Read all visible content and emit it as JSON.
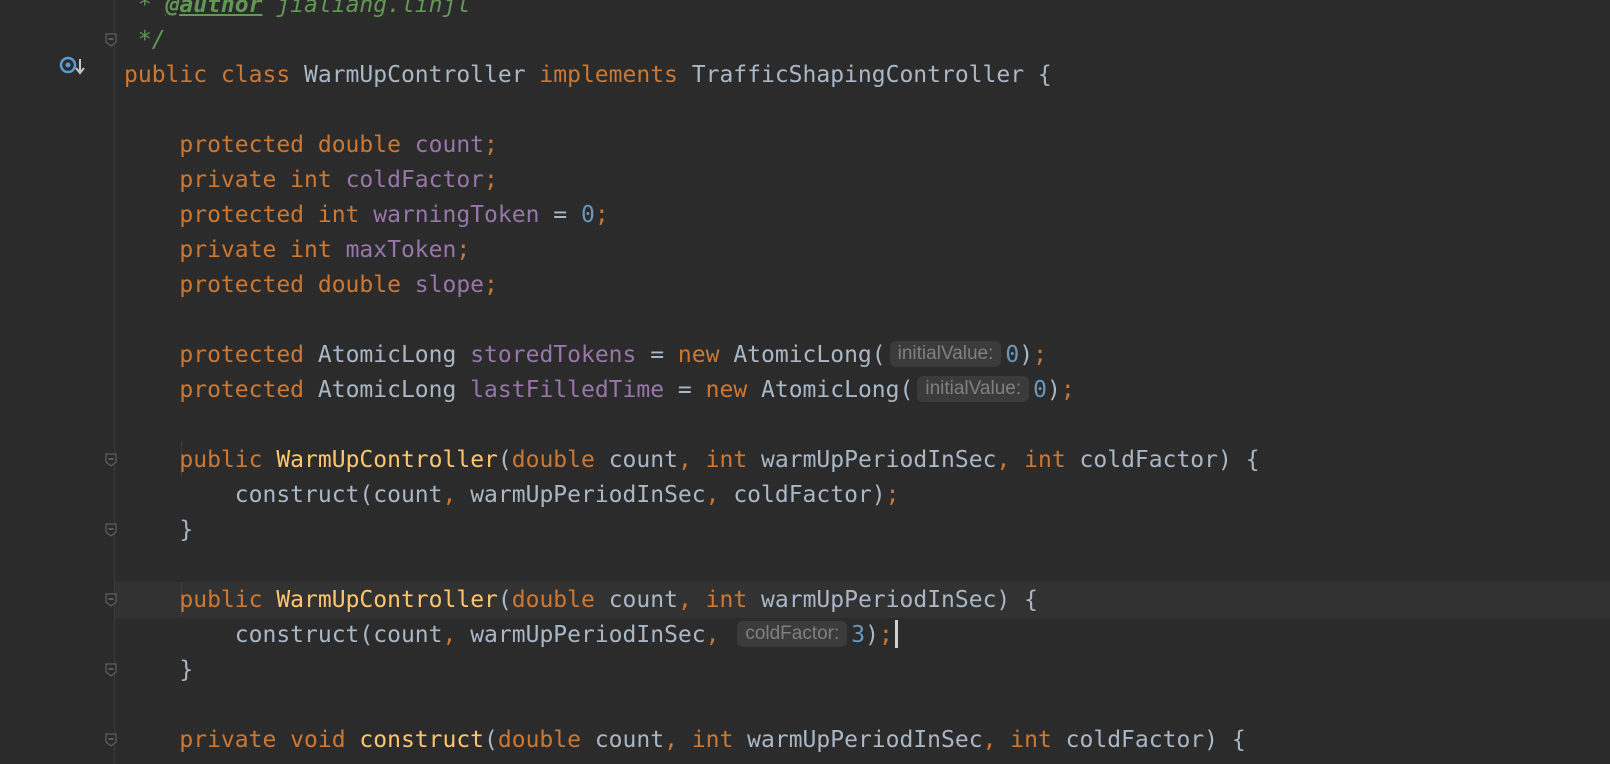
{
  "editor": {
    "language": "Java",
    "caret_line": 17,
    "lines": [
      {
        "tokens": [
          {
            "t": "c",
            "v": " * "
          },
          {
            "t": "tag",
            "v": "@author"
          },
          {
            "t": "c",
            "v": " jialiang.linjl"
          }
        ]
      },
      {
        "tokens": [
          {
            "t": "c",
            "v": " */"
          }
        ]
      },
      {
        "tokens": [
          {
            "t": "k",
            "v": "public class "
          },
          {
            "t": "p",
            "v": "WarmUpController "
          },
          {
            "t": "k",
            "v": "implements "
          },
          {
            "t": "p",
            "v": "TrafficShapingController {"
          }
        ]
      },
      {
        "tokens": []
      },
      {
        "tokens": [
          {
            "t": "p",
            "v": "    "
          },
          {
            "t": "k",
            "v": "protected double "
          },
          {
            "t": "f",
            "v": "count"
          },
          {
            "t": "k",
            "v": ";"
          }
        ]
      },
      {
        "tokens": [
          {
            "t": "p",
            "v": "    "
          },
          {
            "t": "k",
            "v": "private int "
          },
          {
            "t": "f",
            "v": "coldFactor"
          },
          {
            "t": "k",
            "v": ";"
          }
        ]
      },
      {
        "tokens": [
          {
            "t": "p",
            "v": "    "
          },
          {
            "t": "k",
            "v": "protected int "
          },
          {
            "t": "f",
            "v": "warningToken "
          },
          {
            "t": "p",
            "v": "= "
          },
          {
            "t": "n",
            "v": "0"
          },
          {
            "t": "k",
            "v": ";"
          }
        ]
      },
      {
        "tokens": [
          {
            "t": "p",
            "v": "    "
          },
          {
            "t": "k",
            "v": "private int "
          },
          {
            "t": "f",
            "v": "maxToken"
          },
          {
            "t": "k",
            "v": ";"
          }
        ]
      },
      {
        "tokens": [
          {
            "t": "p",
            "v": "    "
          },
          {
            "t": "k",
            "v": "protected double "
          },
          {
            "t": "f",
            "v": "slope"
          },
          {
            "t": "k",
            "v": ";"
          }
        ]
      },
      {
        "tokens": []
      },
      {
        "tokens": [
          {
            "t": "p",
            "v": "    "
          },
          {
            "t": "k",
            "v": "protected "
          },
          {
            "t": "p",
            "v": "AtomicLong "
          },
          {
            "t": "f",
            "v": "storedTokens "
          },
          {
            "t": "p",
            "v": "= "
          },
          {
            "t": "k",
            "v": "new "
          },
          {
            "t": "p",
            "v": "AtomicLong("
          },
          {
            "t": "h",
            "v": "initialValue:"
          },
          {
            "t": "n",
            "v": "0"
          },
          {
            "t": "p",
            "v": ")"
          },
          {
            "t": "k",
            "v": ";"
          }
        ]
      },
      {
        "tokens": [
          {
            "t": "p",
            "v": "    "
          },
          {
            "t": "k",
            "v": "protected "
          },
          {
            "t": "p",
            "v": "AtomicLong "
          },
          {
            "t": "f",
            "v": "lastFilledTime "
          },
          {
            "t": "p",
            "v": "= "
          },
          {
            "t": "k",
            "v": "new "
          },
          {
            "t": "p",
            "v": "AtomicLong("
          },
          {
            "t": "h",
            "v": "initialValue:"
          },
          {
            "t": "n",
            "v": "0"
          },
          {
            "t": "p",
            "v": ")"
          },
          {
            "t": "k",
            "v": ";"
          }
        ]
      },
      {
        "tokens": []
      },
      {
        "tokens": [
          {
            "t": "p",
            "v": "    "
          },
          {
            "t": "k",
            "v": "public "
          },
          {
            "t": "fn",
            "v": "WarmUpController"
          },
          {
            "t": "p",
            "v": "("
          },
          {
            "t": "k",
            "v": "double "
          },
          {
            "t": "p",
            "v": "count"
          },
          {
            "t": "k",
            "v": ", int "
          },
          {
            "t": "p",
            "v": "warmUpPeriodInSec"
          },
          {
            "t": "k",
            "v": ", int "
          },
          {
            "t": "p",
            "v": "coldFactor) {"
          }
        ]
      },
      {
        "tokens": [
          {
            "t": "p",
            "v": "        construct(count"
          },
          {
            "t": "k",
            "v": ", "
          },
          {
            "t": "p",
            "v": "warmUpPeriodInSec"
          },
          {
            "t": "k",
            "v": ", "
          },
          {
            "t": "p",
            "v": "coldFactor)"
          },
          {
            "t": "k",
            "v": ";"
          }
        ]
      },
      {
        "tokens": [
          {
            "t": "p",
            "v": "    }"
          }
        ]
      },
      {
        "tokens": []
      },
      {
        "tokens": [
          {
            "t": "p",
            "v": "    "
          },
          {
            "t": "k",
            "v": "public "
          },
          {
            "t": "fn",
            "v": "WarmUpController"
          },
          {
            "t": "p",
            "v": "("
          },
          {
            "t": "k",
            "v": "double "
          },
          {
            "t": "p",
            "v": "count"
          },
          {
            "t": "k",
            "v": ", int "
          },
          {
            "t": "p",
            "v": "warmUpPeriodInSec) {"
          }
        ]
      },
      {
        "tokens": [
          {
            "t": "p",
            "v": "        construct(count"
          },
          {
            "t": "k",
            "v": ", "
          },
          {
            "t": "p",
            "v": "warmUpPeriodInSec"
          },
          {
            "t": "k",
            "v": ", "
          },
          {
            "t": "h",
            "v": "coldFactor:"
          },
          {
            "t": "n",
            "v": "3"
          },
          {
            "t": "p",
            "v": ")"
          },
          {
            "t": "k",
            "v": ";"
          },
          {
            "t": "caret",
            "v": ""
          }
        ]
      },
      {
        "tokens": [
          {
            "t": "p",
            "v": "    }"
          }
        ]
      },
      {
        "tokens": []
      },
      {
        "tokens": [
          {
            "t": "p",
            "v": "    "
          },
          {
            "t": "k",
            "v": "private void "
          },
          {
            "t": "fn",
            "v": "construct"
          },
          {
            "t": "p",
            "v": "("
          },
          {
            "t": "k",
            "v": "double "
          },
          {
            "t": "p",
            "v": "count"
          },
          {
            "t": "k",
            "v": ", int "
          },
          {
            "t": "p",
            "v": "warmUpPeriodInSec"
          },
          {
            "t": "k",
            "v": ", int "
          },
          {
            "t": "p",
            "v": "coldFactor) {"
          }
        ]
      }
    ]
  },
  "gutter": {
    "class_icon": "implementation-marker-icon",
    "fold_lines": [
      1,
      13,
      15,
      17,
      19,
      21
    ],
    "fold_icon": "fold-marker-icon"
  },
  "colors": {
    "background": "#2b2b2b",
    "current_line": "#323232",
    "keyword": "#cc7832",
    "field": "#9876aa",
    "number": "#6897bb",
    "method": "#ffc66d",
    "plain": "#a9b7c6",
    "comment": "#629755",
    "hint_bg": "#3b3b3b",
    "hint_text": "#808080"
  }
}
